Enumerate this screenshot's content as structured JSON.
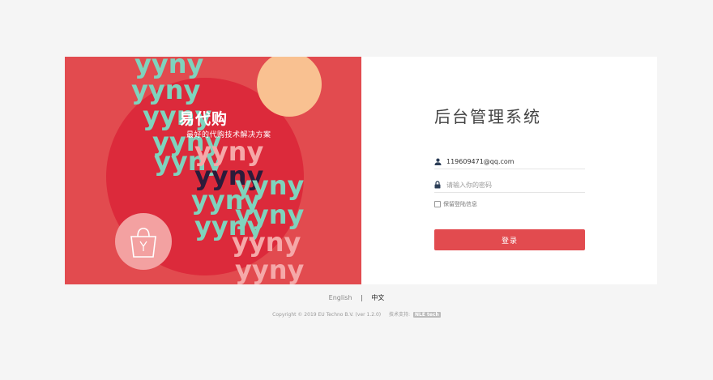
{
  "brand": {
    "title": "易代购",
    "subtitle": "最好的代购技术解决方案",
    "pattern_text": "yyny"
  },
  "login": {
    "title": "后台管理系统",
    "username": {
      "value": "119609471@qq.com",
      "placeholder": ""
    },
    "password": {
      "value": "",
      "placeholder": "请输入你的密码"
    },
    "remember_label": "保留登陆信息",
    "remember_checked": false,
    "submit_label": "登录"
  },
  "language": {
    "options": [
      "English",
      "中文"
    ],
    "separator": "|",
    "active": "中文"
  },
  "footer": {
    "copyright": "Copyright © 2019 EU Techno B.V. (ver 1.2.0)",
    "support_label": "技术支持:",
    "support_logo": "NLE tech"
  },
  "colors": {
    "primary": "#e24b4f",
    "circle": "#dc2a3b",
    "peach": "#f9c191",
    "mint": "#7fd3bd",
    "pink": "#f5a8a8"
  },
  "icons": {
    "user": "user-icon",
    "lock": "lock-icon",
    "bag": "shopping-bag-icon"
  }
}
